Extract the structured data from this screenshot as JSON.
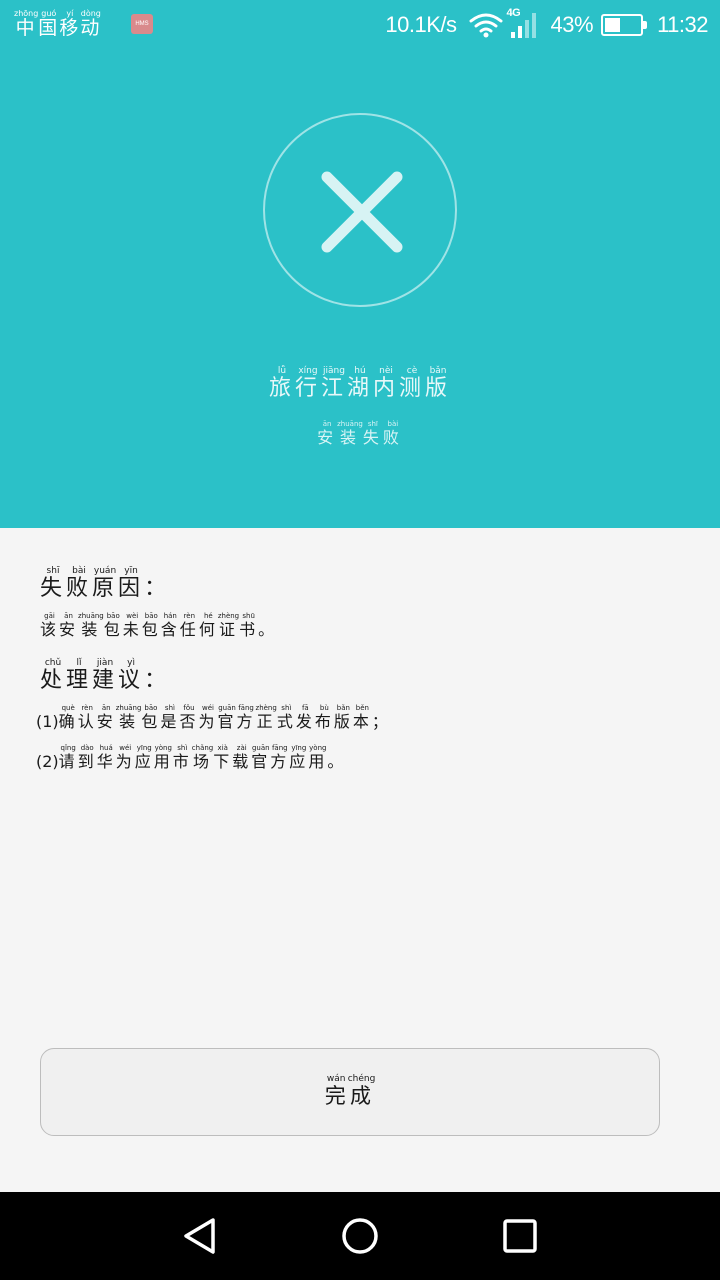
{
  "status_bar": {
    "carrier": [
      "中",
      "国",
      "移",
      "动"
    ],
    "carrier_pinyin": [
      "zhōng",
      "guó",
      "yí",
      "dòng"
    ],
    "hms_badge": "HMS",
    "net_speed": "10.1K/s",
    "network_type": "4G",
    "battery_percent": "43%",
    "battery_level": 0.43,
    "time": "11:32",
    "icons": [
      "wifi-icon",
      "signal-icon",
      "battery-icon"
    ]
  },
  "header": {
    "status_icon": "close-icon",
    "app_name": "旅行江湖内测版",
    "app_name_pinyin": [
      "lǚ",
      "xíng",
      "jiāng",
      "hú",
      "nèi",
      "cè",
      "bǎn"
    ],
    "install_status": "安装失败",
    "install_status_pinyin": [
      "ān",
      "zhuāng",
      "shī",
      "bài"
    ]
  },
  "reason": {
    "title": "失败原因",
    "title_pinyin": [
      "shī",
      "bài",
      "yuán",
      "yīn"
    ],
    "title_suffix": "：",
    "text": "该安装包未包含任何证书",
    "text_pinyin": [
      "gāi",
      "ān",
      "zhuāng",
      "bāo",
      "wèi",
      "bāo",
      "hán",
      "rèn",
      "hé",
      "zhèng",
      "shū"
    ],
    "text_suffix": "。"
  },
  "suggestion": {
    "title": "处理建议",
    "title_pinyin": [
      "chǔ",
      "lǐ",
      "jiàn",
      "yì"
    ],
    "title_suffix": "：",
    "items": [
      {
        "prefix": "(1)",
        "text": "确认安装包是否为官方正式发布版本",
        "pinyin": [
          "què",
          "rèn",
          "ān",
          "zhuāng",
          "bāo",
          "shì",
          "fǒu",
          "wéi",
          "guān",
          "fāng",
          "zhèng",
          "shì",
          "fā",
          "bù",
          "bǎn",
          "běn"
        ],
        "suffix": "；"
      },
      {
        "prefix": "(2)",
        "text": "请到华为应用市场下载官方应用",
        "pinyin": [
          "qǐng",
          "dào",
          "huá",
          "wéi",
          "yīng",
          "yòng",
          "shì",
          "chǎng",
          "xià",
          "zài",
          "guān",
          "fāng",
          "yīng",
          "yòng"
        ],
        "suffix": "。"
      }
    ]
  },
  "done_button": {
    "label": "完成",
    "pinyin": [
      "wán",
      "chéng"
    ]
  },
  "nav_bar": {
    "buttons": [
      "back-icon",
      "home-icon",
      "recents-icon"
    ]
  },
  "colors": {
    "header_bg": "#2bc1c8",
    "content_bg": "#f5f5f5",
    "nav_bg": "#000000"
  }
}
